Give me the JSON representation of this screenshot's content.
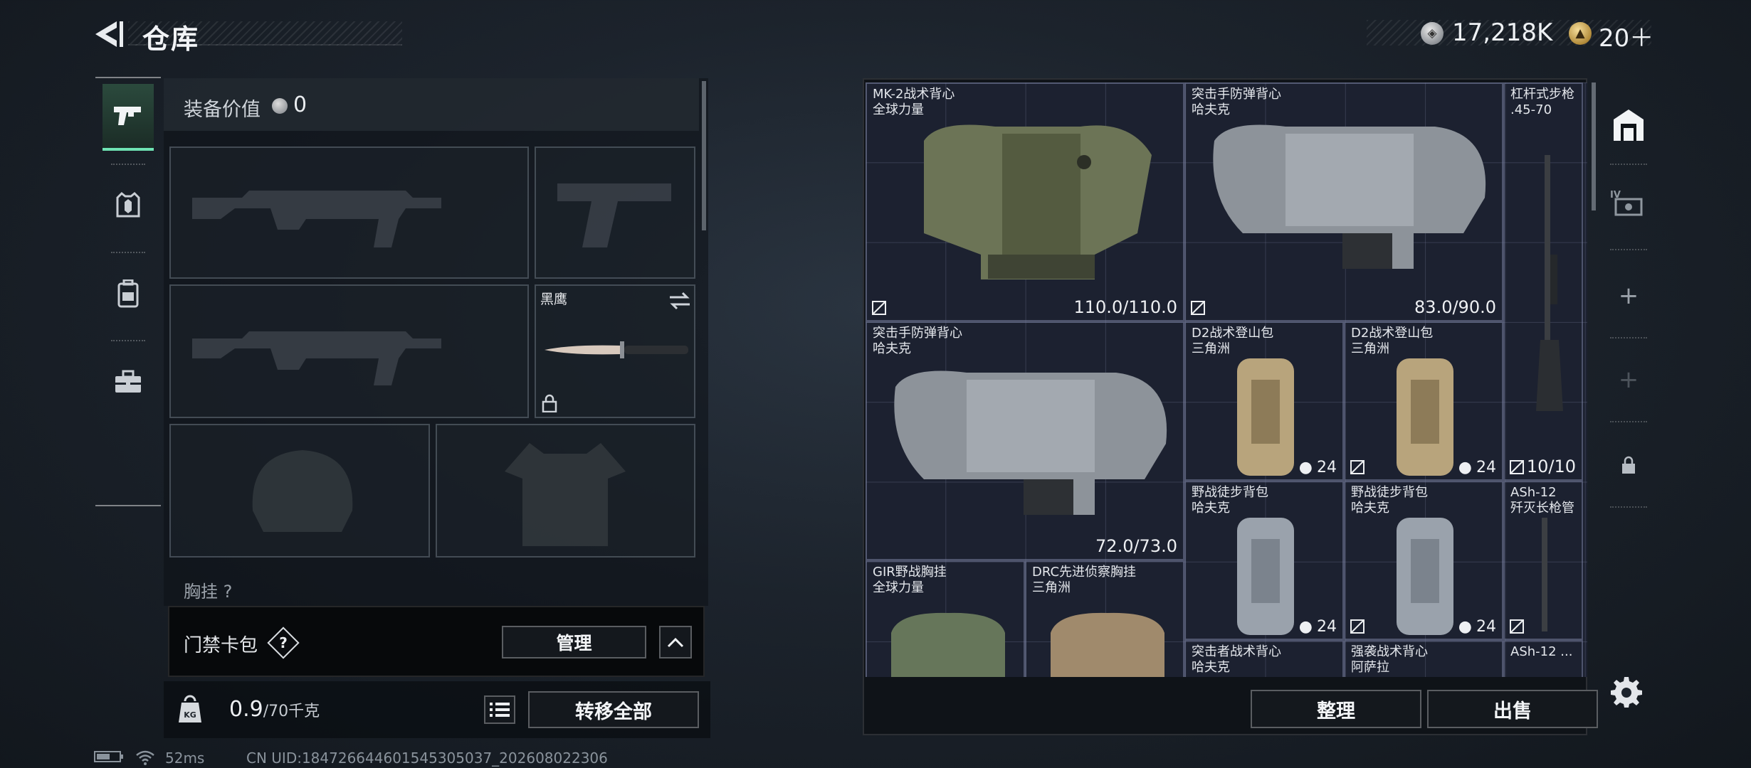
{
  "header": {
    "title": "仓库",
    "currency": {
      "silver": "17,218K",
      "gold": "20＋"
    }
  },
  "loadout": {
    "equipment_value_label": "装备价值",
    "equipment_value": "0",
    "knife_label": "黑鹰",
    "chest_rig_label": "胸挂",
    "access_card": {
      "label": "门禁卡包",
      "help": "?",
      "manage_button": "管理"
    },
    "weight": {
      "current": "0.9",
      "max": "/70千克"
    },
    "transfer_all_button": "转移全部"
  },
  "storage": {
    "items": [
      {
        "name": "MK-2战术背心",
        "sub": "全球力量",
        "durability": "110.0/110.0"
      },
      {
        "name": "突击手防弹背心",
        "sub": "哈夫克",
        "durability": "83.0/90.0"
      },
      {
        "name": "杠杆式步枪",
        "sub": ".45-70",
        "count": "10/10"
      },
      {
        "name": "突击手防弹背心",
        "sub": "哈夫克",
        "durability": "72.0/73.0"
      },
      {
        "name": "D2战术登山包",
        "sub": "三角洲",
        "capacity": "24"
      },
      {
        "name": "D2战术登山包",
        "sub": "三角洲",
        "capacity": "24"
      },
      {
        "name": "野战徒步背包",
        "sub": "哈夫克",
        "capacity": "24"
      },
      {
        "name": "野战徒步背包",
        "sub": "哈夫克",
        "capacity": "24"
      },
      {
        "name": "ASh-12",
        "sub": "歼灭长枪管"
      },
      {
        "name": "GIR野战胸挂",
        "sub": "全球力量"
      },
      {
        "name": "DRC先进侦察胸挂",
        "sub": "三角洲"
      },
      {
        "name": "突击者战术背心",
        "sub": "哈夫克"
      },
      {
        "name": "强袭战术背心",
        "sub": "阿萨拉"
      },
      {
        "name": "ASh-12 ...",
        "sub": ""
      }
    ],
    "sort_button": "整理",
    "sell_button": "出售"
  },
  "status_bar": {
    "ping": "52ms",
    "uid": "CN UID:184726644601545305037_202608022306"
  },
  "colors": {
    "accent_green": "#6fe3b3",
    "panel_dark": "#0f1318",
    "grid_bg": "#1c2130"
  }
}
